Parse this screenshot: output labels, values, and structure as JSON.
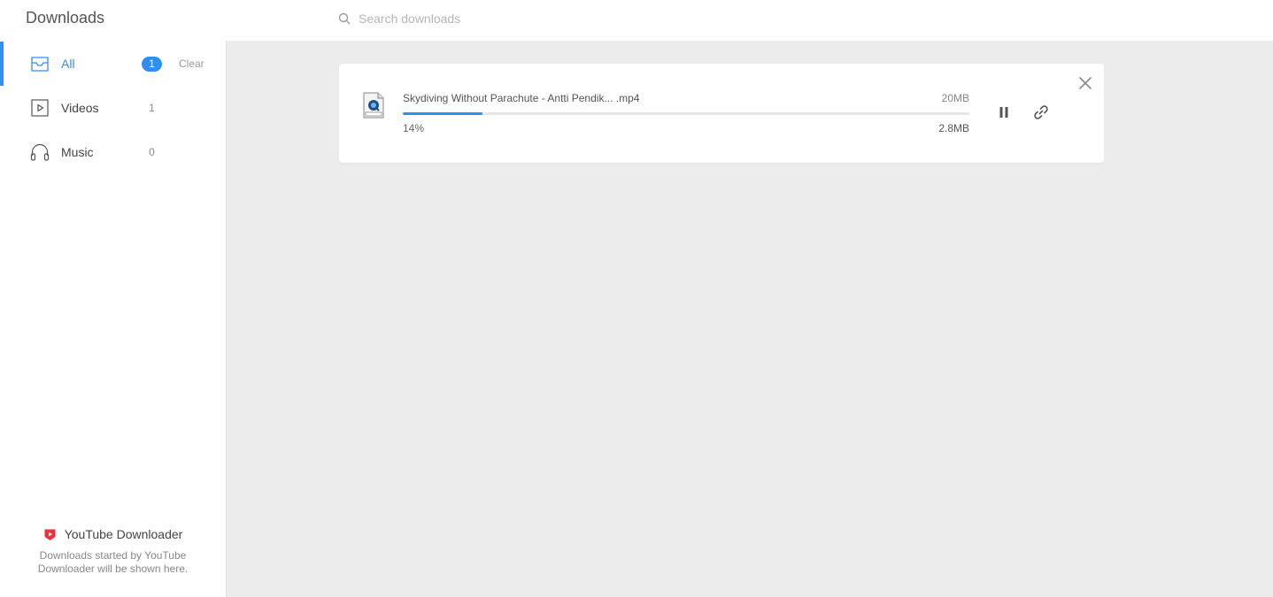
{
  "header": {
    "title": "Downloads",
    "search_placeholder": "Search downloads",
    "search_value": ""
  },
  "sidebar": {
    "items": [
      {
        "label": "All",
        "count": "1",
        "icon": "inbox-icon",
        "active": true
      },
      {
        "label": "Videos",
        "count": "1",
        "icon": "video-icon",
        "active": false
      },
      {
        "label": "Music",
        "count": "0",
        "icon": "headphones-icon",
        "active": false
      }
    ],
    "clear_label": "Clear"
  },
  "promo": {
    "title": "YouTube Downloader",
    "text": "Downloads started by YouTube Downloader will be shown here.",
    "icon": "youtube-icon"
  },
  "downloads": [
    {
      "file_name": "Skydiving Without Parachute - Antti Pendik... .mp4",
      "total_size": "20MB",
      "progress_label": "14%",
      "progress": 0.14,
      "downloaded_size": "2.8MB",
      "file_icon": "mpeg-file-icon"
    }
  ],
  "colors": {
    "accent": "#2f8ff0",
    "main_bg": "#ececec",
    "youtube_red": "#e8323c"
  }
}
